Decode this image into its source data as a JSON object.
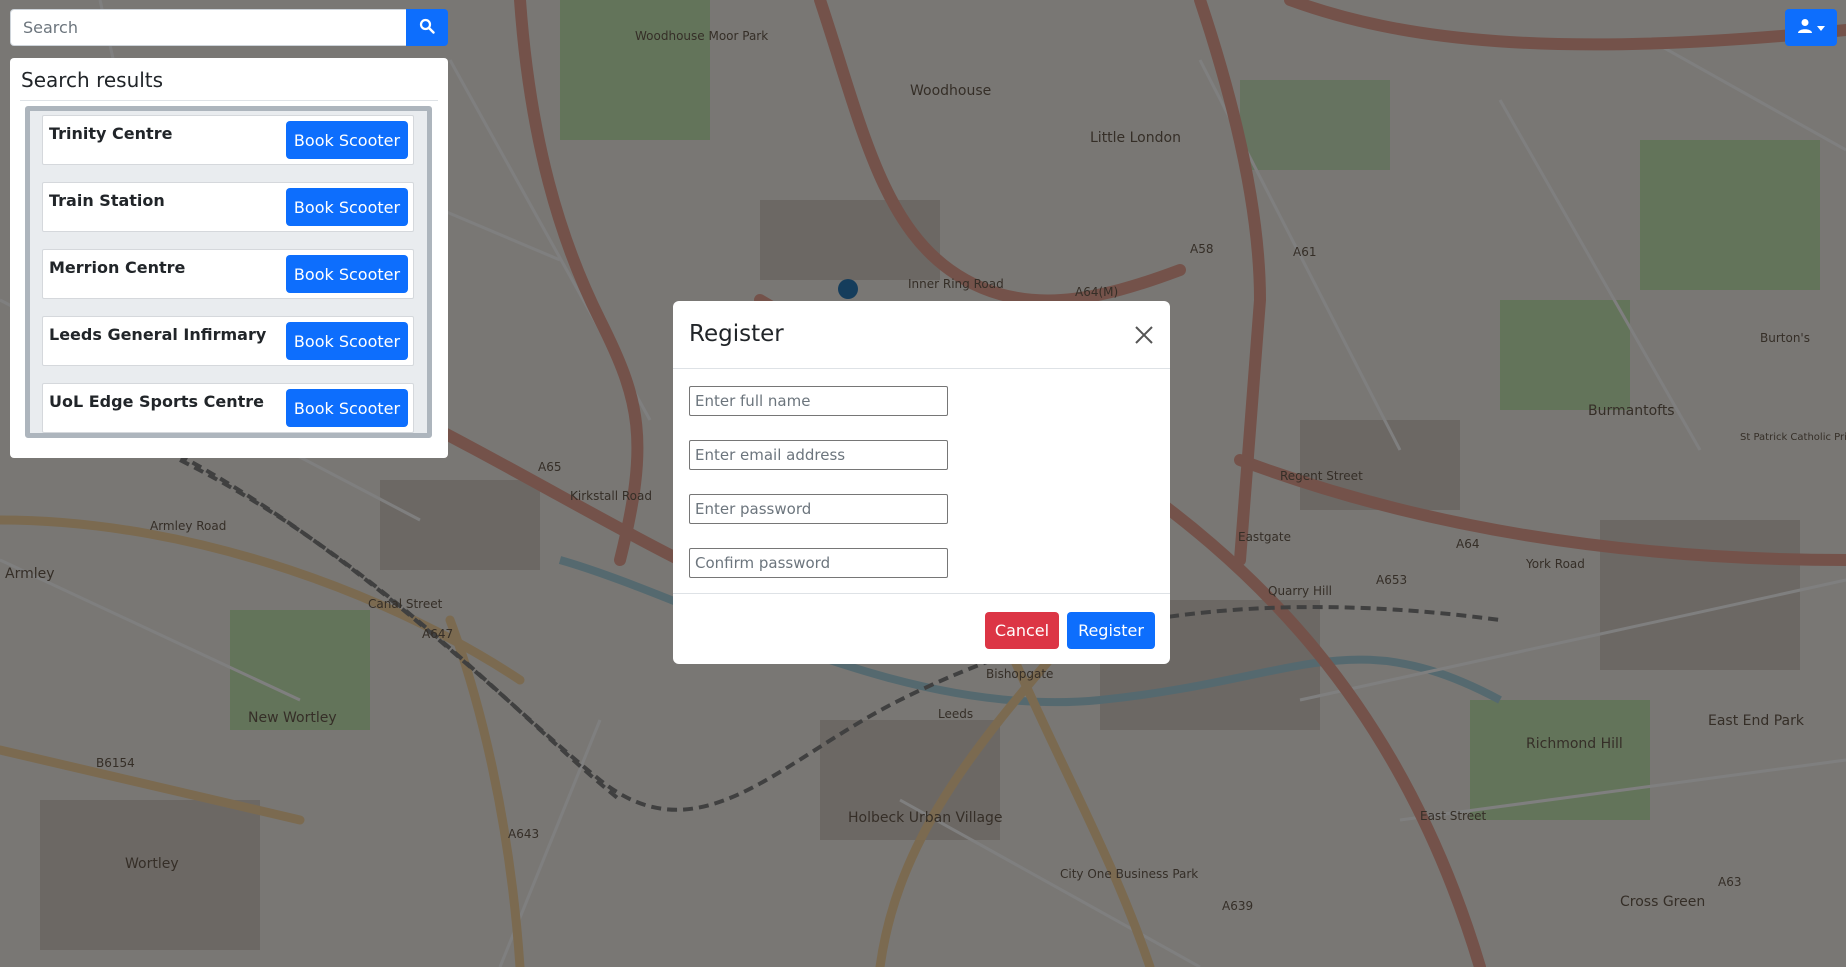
{
  "search": {
    "placeholder": "Search",
    "button_icon": "search-icon"
  },
  "results": {
    "title": "Search results",
    "items": [
      {
        "name": "Trinity Centre",
        "button": "Book Scooter"
      },
      {
        "name": "Train Station",
        "button": "Book Scooter"
      },
      {
        "name": "Merrion Centre",
        "button": "Book Scooter"
      },
      {
        "name": "Leeds General Infirmary",
        "button": "Book Scooter"
      },
      {
        "name": "UoL Edge Sports Centre",
        "button": "Book Scooter"
      }
    ]
  },
  "user_menu": {
    "icon": "user-icon",
    "caret_icon": "caret-down-icon"
  },
  "map": {
    "labels": {
      "woodhouse_moor_park": "Woodhouse Moor Park",
      "woodhouse": "Woodhouse",
      "little_london": "Little London",
      "burmantofts": "Burmantofts",
      "armley": "Armley",
      "new_wortley": "New Wortley",
      "holbeck_urban_village": "Holbeck Urban Village",
      "richmond_hill": "Richmond Hill",
      "east_end_park": "East End Park",
      "cross_green": "Cross Green",
      "wortley": "Wortley",
      "leeds": "Leeds",
      "quarry_hill": "Quarry Hill",
      "eastgate": "Eastgate",
      "regent_street": "Regent Street",
      "a64m": "A64(M)",
      "a58": "A58",
      "a61": "A61",
      "a65": "A65",
      "a647": "A647",
      "a653": "A653",
      "a639": "A639",
      "a643": "A643",
      "a63": "A63",
      "a64": "A64",
      "b6154": "B6154",
      "inner_ring_road": "Inner Ring Road",
      "armley_road": "Armley Road",
      "canal_street": "Canal Street",
      "kirkstall_road": "Kirkstall Road",
      "york_road": "York Road",
      "east_street": "East Street",
      "burtons": "Burton's",
      "bishopgate": "Bishopgate",
      "city_one_business_park": "City One Business Park",
      "st_patrick_catholic_primary_school": "St Patrick Catholic Primary School"
    },
    "colors": {
      "base": "#f2efe9",
      "primary_road": "#e8a595",
      "secondary_road": "#f6d5a0",
      "park": "#c7e8b5",
      "building": "#d9d0c9",
      "rail": "#808080"
    }
  },
  "modal": {
    "title": "Register",
    "close_icon": "close-icon",
    "fields": {
      "full_name": {
        "placeholder": "Enter full name",
        "value": ""
      },
      "email": {
        "placeholder": "Enter email address",
        "value": ""
      },
      "password": {
        "placeholder": "Enter password",
        "value": ""
      },
      "confirm_password": {
        "placeholder": "Confirm password",
        "value": ""
      }
    },
    "cancel_label": "Cancel",
    "register_label": "Register"
  },
  "colors": {
    "primary": "#0d6efd",
    "danger": "#dc3545",
    "overlay": "rgba(0,0,0,0.5)"
  }
}
